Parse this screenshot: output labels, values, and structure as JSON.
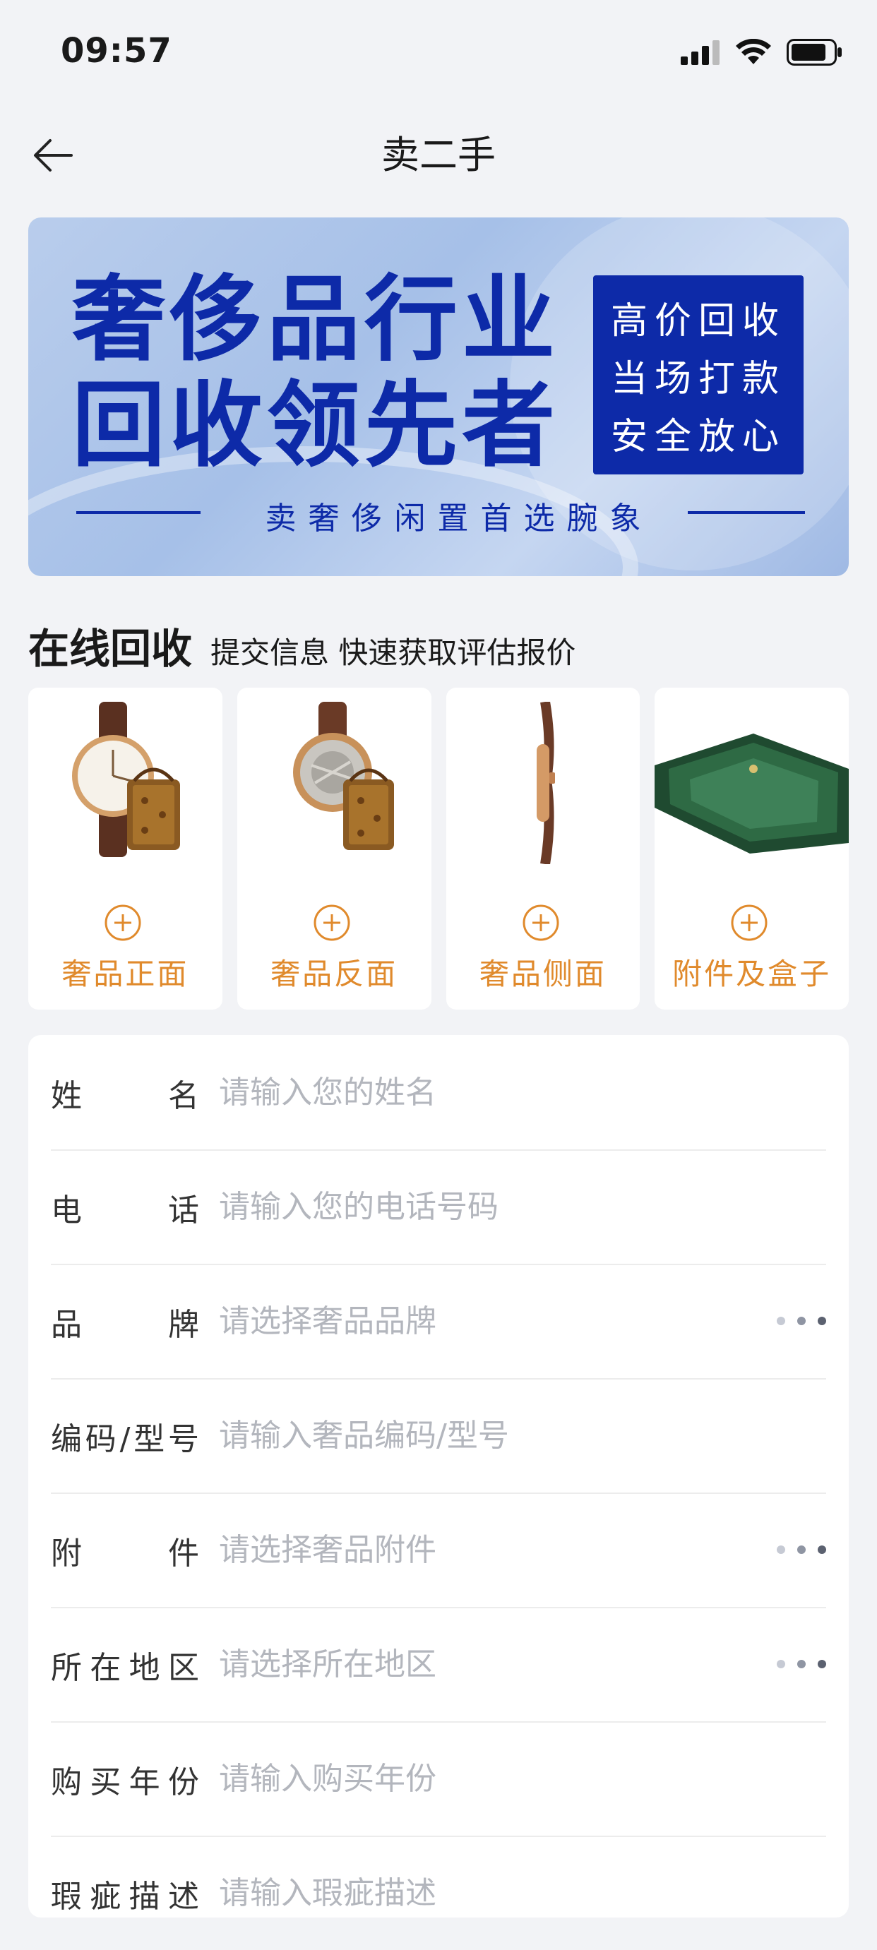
{
  "status_bar": {
    "time": "09:57"
  },
  "nav": {
    "title": "卖二手",
    "back_icon": "arrow-left-icon"
  },
  "banner": {
    "headline_line1": "奢侈品行业",
    "headline_line2": "回收领先者",
    "features": [
      "高价回收",
      "当场打款",
      "安全放心"
    ],
    "slogan": "卖奢侈闲置首选腕象",
    "brand_color": "#0d2aa8"
  },
  "section": {
    "title": "在线回收",
    "subtitle": "提交信息 快速获取评估报价"
  },
  "photo_cards": [
    {
      "label": "奢品正面",
      "image": "watch-front-with-bag"
    },
    {
      "label": "奢品反面",
      "image": "watch-back-with-bag"
    },
    {
      "label": "奢品侧面",
      "image": "watch-side"
    },
    {
      "label": "附件及盒子",
      "image": "rolex-green-card"
    }
  ],
  "photo_card_accent": "#e08a2c",
  "form": {
    "fields": [
      {
        "label": "姓名",
        "placeholder": "请输入您的姓名",
        "selectable": false
      },
      {
        "label": "电话",
        "placeholder": "请输入您的电话号码",
        "selectable": false
      },
      {
        "label": "品牌",
        "placeholder": "请选择奢品品牌",
        "selectable": true
      },
      {
        "label": "编码/型号",
        "placeholder": "请输入奢品编码/型号",
        "selectable": false
      },
      {
        "label": "附件",
        "placeholder": "请选择奢品附件",
        "selectable": true
      },
      {
        "label": "所在地区",
        "placeholder": "请选择所在地区",
        "selectable": true
      },
      {
        "label": "购买年份",
        "placeholder": "请输入购买年份",
        "selectable": false
      },
      {
        "label": "瑕疵描述",
        "placeholder": "请输入瑕疵描述",
        "selectable": false
      }
    ]
  }
}
